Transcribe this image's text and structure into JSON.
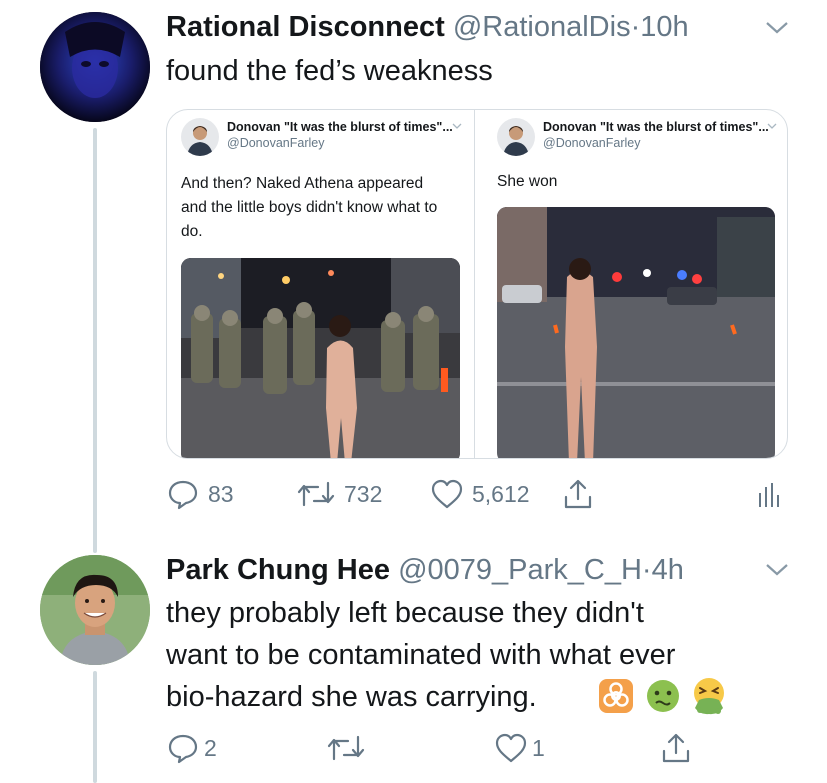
{
  "tweet1": {
    "name": "Rational Disconnect",
    "handle": "@RationalDis",
    "separator": "·",
    "time": "10h",
    "text": "found the fed’s weakness",
    "avatar_icon": "profile-avatar-blue",
    "media": {
      "left": {
        "name": "Donovan \"It was the blurst of times\"...",
        "handle": "@DonovanFarley",
        "text_lines": [
          "And then? Naked Athena appeared",
          "and the little boys didn't know what to",
          "do."
        ]
      },
      "right": {
        "name": "Donovan \"It was the blurst of times\"...",
        "handle": "@DonovanFarley",
        "text_lines": [
          "She won"
        ]
      }
    },
    "actions": {
      "replies": "83",
      "retweets": "732",
      "likes": "5,612"
    }
  },
  "tweet2": {
    "name": "Park Chung Hee",
    "handle": "@0079_Park_C_H",
    "separator": "·",
    "time": "4h",
    "text_lines": [
      "they probably left because they didn't",
      "want to be contaminated with what ever",
      "bio-hazard she was carrying."
    ],
    "emojis": [
      "biohazard-emoji",
      "nauseated-face-emoji",
      "vomiting-face-emoji"
    ],
    "actions": {
      "replies": "2",
      "retweets": "",
      "likes": "1"
    }
  },
  "colors": {
    "text": "#14171a",
    "secondary": "#657786",
    "border": "#d7dde2",
    "thread": "#cfd9de",
    "emoji_orange": "#f28c28",
    "emoji_green": "#77b255"
  }
}
